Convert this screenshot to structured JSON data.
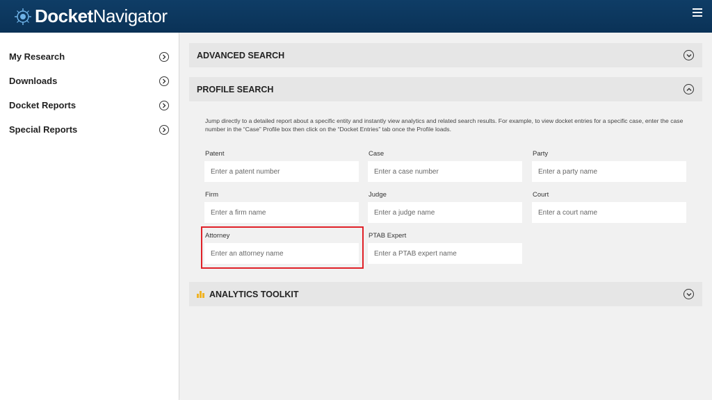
{
  "header": {
    "logo_part1": "Docket",
    "logo_part2": "Navigator",
    "menu_icon": "hamburger-icon",
    "bg_color": "#0b355c"
  },
  "sidebar": {
    "items": [
      {
        "label": "My Research"
      },
      {
        "label": "Downloads"
      },
      {
        "label": "Docket Reports"
      },
      {
        "label": "Special Reports"
      }
    ]
  },
  "main": {
    "advanced_search": {
      "title": "ADVANCED SEARCH",
      "state": "collapsed"
    },
    "profile_search": {
      "title": "PROFILE SEARCH",
      "state": "expanded",
      "intro": "Jump directly to a detailed report about a specific entity and instantly view analytics and related search results. For example, to view docket entries for a specific case, enter the case number in the “Case” Profile box then click on the “Docket Entries” tab once the Profile loads.",
      "fields": [
        {
          "label": "Patent",
          "placeholder": "Enter a patent number"
        },
        {
          "label": "Case",
          "placeholder": "Enter a case number"
        },
        {
          "label": "Party",
          "placeholder": "Enter a party name"
        },
        {
          "label": "Firm",
          "placeholder": "Enter a firm name"
        },
        {
          "label": "Judge",
          "placeholder": "Enter a judge name"
        },
        {
          "label": "Court",
          "placeholder": "Enter a court name"
        },
        {
          "label": "Attorney",
          "placeholder": "Enter an attorney name"
        },
        {
          "label": "PTAB Expert",
          "placeholder": "Enter a PTAB expert name"
        }
      ]
    },
    "analytics_toolkit": {
      "title": "ANALYTICS TOOLKIT",
      "state": "collapsed",
      "icon": "bar-chart-icon"
    }
  },
  "highlight_color": "#e02027"
}
